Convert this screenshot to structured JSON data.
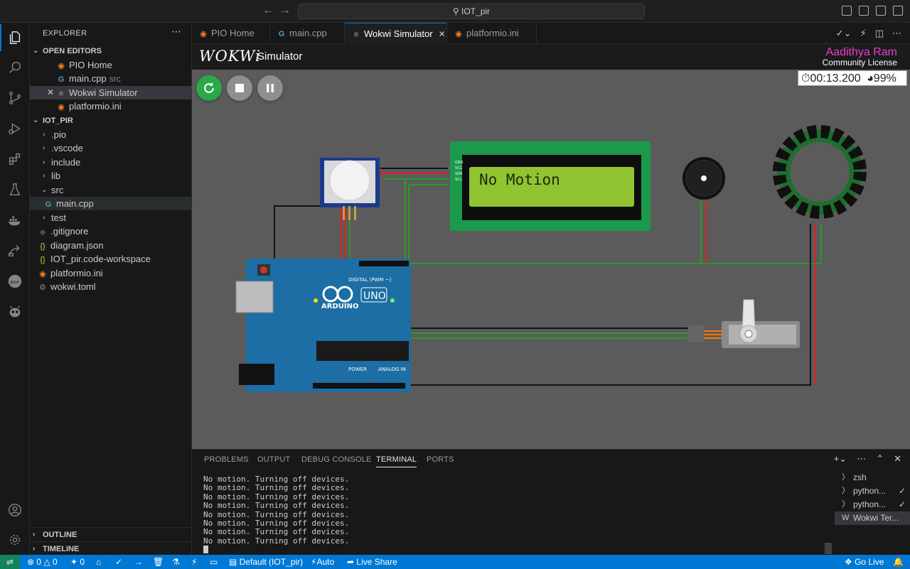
{
  "titlebar": {
    "search_text": "IOT_pir"
  },
  "sidebar": {
    "title": "EXPLORER",
    "open_editors_label": "OPEN EDITORS",
    "open_editors": [
      {
        "name": "PIO Home",
        "desc": ""
      },
      {
        "name": "main.cpp",
        "desc": "src"
      },
      {
        "name": "Wokwi Simulator",
        "desc": ""
      },
      {
        "name": "platformio.ini",
        "desc": ""
      }
    ],
    "project_label": "IOT_PIR",
    "tree": [
      ".pio",
      ".vscode",
      "include",
      "lib",
      "src",
      "main.cpp",
      "test",
      ".gitignore",
      "diagram.json",
      "IOT_pir.code-workspace",
      "platformio.ini",
      "wokwi.toml"
    ],
    "outline_label": "OUTLINE",
    "timeline_label": "TIMELINE"
  },
  "tabs": [
    "PIO Home",
    "main.cpp",
    "Wokwi Simulator",
    "platformio.ini"
  ],
  "wokwi": {
    "logo": "WOKWi",
    "title": "Simulator",
    "user": "Aadithya Ram",
    "license": "Community License",
    "timer": "00:13.200",
    "speed": "99%",
    "lcd_text": "No Motion",
    "board_brand": "ARDUINO",
    "board_model": "UNO",
    "board_digital": "DIGITAL (PWM ~)",
    "board_analog": "ANALOG IN",
    "board_power": "POWER",
    "pin_labels": [
      "GND",
      "VCC",
      "SDA",
      "SCL"
    ],
    "accent_green": "#2aa84a",
    "lcd_green": "#90c431"
  },
  "panel": {
    "tabs": [
      "PROBLEMS",
      "OUTPUT",
      "DEBUG CONSOLE",
      "TERMINAL",
      "PORTS"
    ],
    "terminal_lines": [
      "No motion. Turning off devices.",
      "No motion. Turning off devices.",
      "No motion. Turning off devices.",
      "No motion. Turning off devices.",
      "No motion. Turning off devices.",
      "No motion. Turning off devices.",
      "No motion. Turning off devices.",
      "No motion. Turning off devices."
    ],
    "terminals": [
      "zsh",
      "python...",
      "python...",
      "Wokwi Ter..."
    ]
  },
  "statusbar": {
    "errors": "0",
    "warnings": "0",
    "ports": "0",
    "env": "Default (IOT_pir)",
    "auto": "Auto",
    "live_share": "Live Share",
    "go_live": "Go Live"
  },
  "colors": {
    "accent": "#0078d4",
    "remote": "#16825d",
    "brand_magenta": "#e83ed0"
  }
}
